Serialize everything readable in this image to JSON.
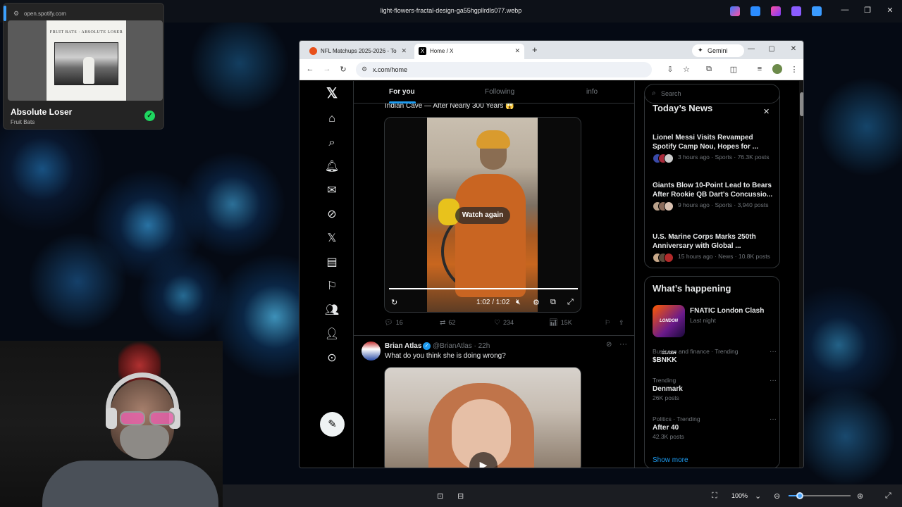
{
  "desktop": {
    "window_title": "light-flowers-fractal-design-ga55hgpllrdls077.webp"
  },
  "spotify": {
    "url": "open.spotify.com",
    "album_header": "FRUIT BATS · ABSOLUTE LOSER",
    "track_title": "Absolute Loser",
    "artist": "Fruit Bats"
  },
  "viewer": {
    "zoom": "100%"
  },
  "browser": {
    "tabs": [
      {
        "label": "NFL Matchups 2025-2026 - Tod",
        "active": false
      },
      {
        "label": "Home / X",
        "active": true
      }
    ],
    "gemini_label": "Gemini",
    "url": "x.com/home"
  },
  "x": {
    "timeline_tabs": [
      "For you",
      "Following",
      "info"
    ],
    "tweet1": {
      "text_partial": "Indian Cave — After Nearly 300 Years 😱",
      "overlay": "Watch again",
      "time": "1:02 / 1:02",
      "replies": "16",
      "reposts": "62",
      "likes": "234",
      "views": "15K"
    },
    "tweet2": {
      "name": "Brian Atlas",
      "handle": "@BrianAtlas · 22h",
      "text": "What do you think she is doing wrong?"
    },
    "search_placeholder": "Search",
    "todays_news": {
      "title": "Today’s News",
      "items": [
        {
          "headline": "Lionel Messi Visits Revamped Spotify Camp Nou, Hopes for ...",
          "meta": "3 hours ago · Sports · 76.3K posts"
        },
        {
          "headline": "Giants Blow 10-Point Lead to Bears After Rookie QB Dart's Concussio...",
          "meta": "9 hours ago · Sports · 3,940 posts"
        },
        {
          "headline": "U.S. Marine Corps Marks 250th Anniversary with Global ...",
          "meta": "15 hours ago · News · 10.8K posts"
        }
      ]
    },
    "happening": {
      "title": "What’s happening",
      "event_title": "FNATIC London Clash",
      "event_sub": "Last night",
      "event_image_text": "LONDON CLASH",
      "trends": [
        {
          "category": "Business and finance · Trending",
          "name": "$BNKK",
          "posts": ""
        },
        {
          "category": "Trending",
          "name": "Denmark",
          "posts": "26K posts"
        },
        {
          "category": "Politics · Trending",
          "name": "After 40",
          "posts": "42.3K posts"
        }
      ],
      "show_more": "Show more"
    }
  }
}
